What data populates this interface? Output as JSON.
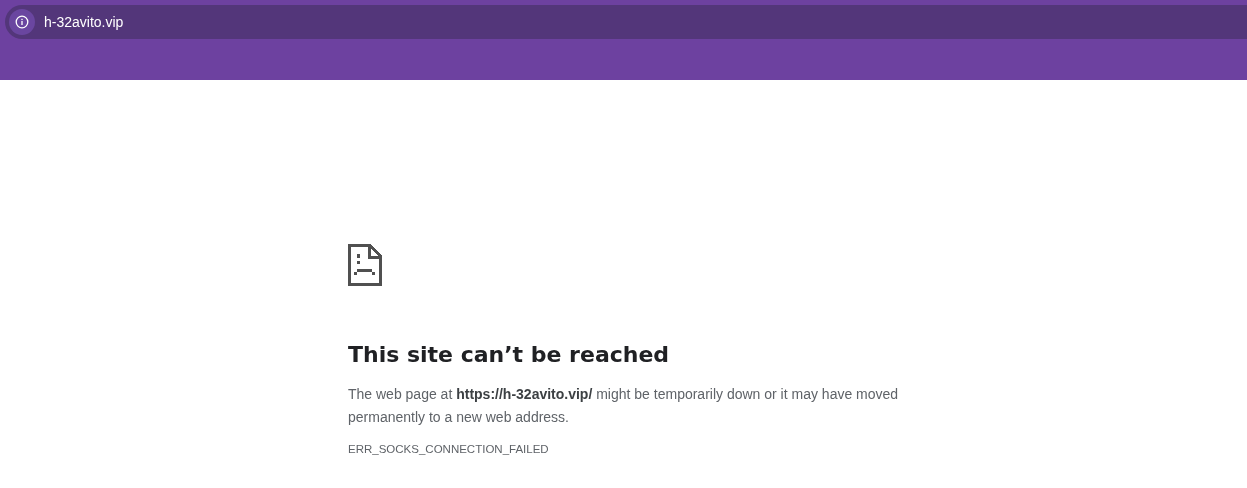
{
  "address_bar": {
    "url": "h-32avito.vip"
  },
  "error": {
    "title": "This site can’t be reached",
    "message": "The web page at **https://h-32avito.vip/** might be temporarily down or it may have moved permanently to a new web address.",
    "code": "ERR_SOCKS_CONNECTION_FAILED"
  }
}
